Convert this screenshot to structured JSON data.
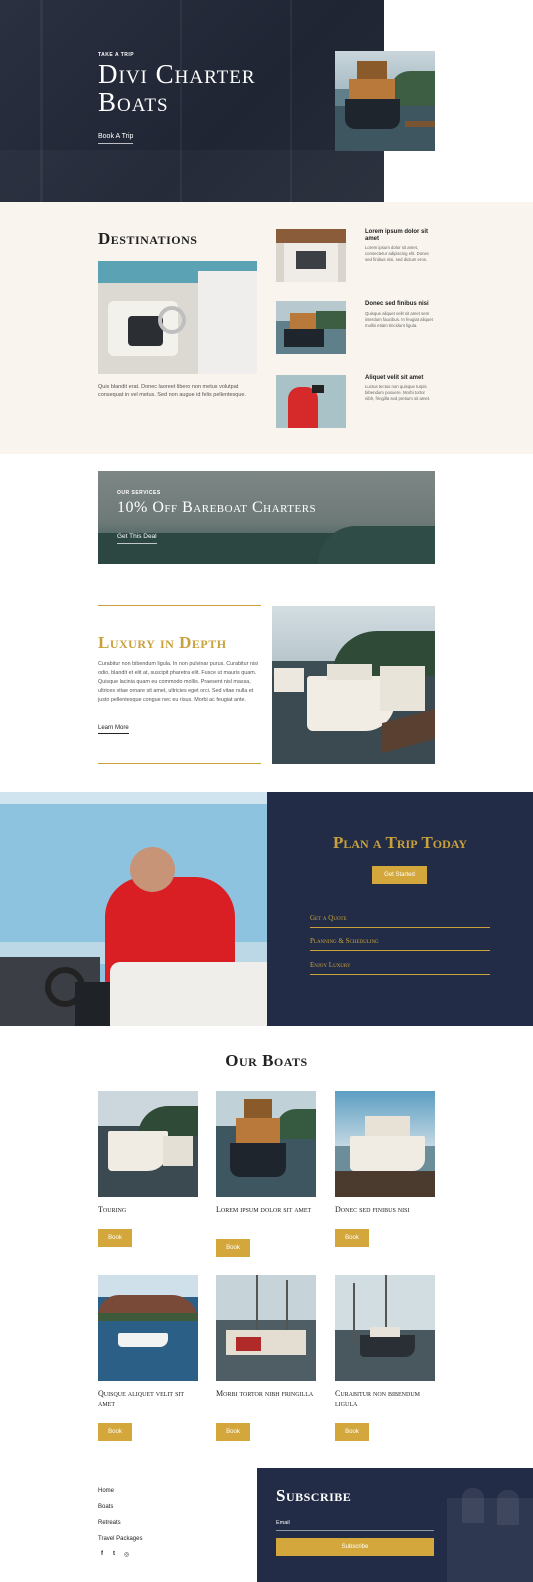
{
  "hero": {
    "eyebrow": "TAKE A TRIP",
    "title_line1": "Divi Charter",
    "title_line2": "Boats",
    "link": "Book A Trip"
  },
  "destinations": {
    "title": "Destinations",
    "body": "Quis blandit erat. Donec laoreet libero non metus volutpat consequat in vel metus. Sed non augue id felis pellentesque.",
    "items": [
      {
        "title": "Lorem ipsum dolor sit amet",
        "body": "Lorem ipsum dolor sit amet, consectetur adipiscing elit. Donec sed finibus nisi, sed dictum eros."
      },
      {
        "title": "Donec sed finibus nisi",
        "body": "Quisque aliquet velit sit amet sem interdum faucibus. In feugiat aliquet mollis etiam tincidunt ligula."
      },
      {
        "title": "Aliquet velit sit amet",
        "body": "Luctus tectus non quisque turpis bibendum posuere. Morbi tortor nibh, fringilla sed pretium sit amet."
      }
    ]
  },
  "banner": {
    "eyebrow": "OUR SERVICES",
    "title": "10% Off Bareboat Charters",
    "link": "Get This Deal"
  },
  "luxury": {
    "title": "Luxury in Depth",
    "body": "Curabitur non bibendum ligula. In non pulvinar purus. Curabitur nisi odio, blandit et elit at, suscipit pharetra elit. Fusce ut mauris quam. Quisque lacinia quam eu commodo mollis. Praesent nisl massa, ultrices vitae ornare sit amet, ultricies eget orci. Sed vitae nulla et justo pellentesque congue nec eu risus. Morbi ac feugiat ante.",
    "link": "Learn More"
  },
  "plan": {
    "title": "Plan a Trip Today",
    "button": "Get Started",
    "links": [
      "Get a Quote",
      "Planning & Scheduling",
      "Enjoy Luxury"
    ]
  },
  "boats": {
    "title": "Our Boats",
    "button_label": "Book",
    "items": [
      {
        "name": "Touring"
      },
      {
        "name": "Lorem ipsum dolor sit amet"
      },
      {
        "name": "Donec sed finibus nisi"
      },
      {
        "name": "Quisque aliquet velit sit amet"
      },
      {
        "name": "Morbi tortor nibh fringilla"
      },
      {
        "name": "Curabitur non bibendum ligula"
      }
    ]
  },
  "footer": {
    "links": [
      "Home",
      "Boats",
      "Retreats",
      "Travel Packages"
    ],
    "social": [
      "facebook-icon",
      "twitter-icon",
      "instagram-icon"
    ],
    "social_glyphs": [
      "f",
      "t",
      "◎"
    ]
  },
  "subscribe": {
    "title": "Subscribe",
    "email_placeholder": "Email",
    "button": "Subscribe"
  },
  "colors": {
    "navy": "#232c47",
    "gold": "#c9a13c",
    "cream": "#f9f4ed"
  }
}
